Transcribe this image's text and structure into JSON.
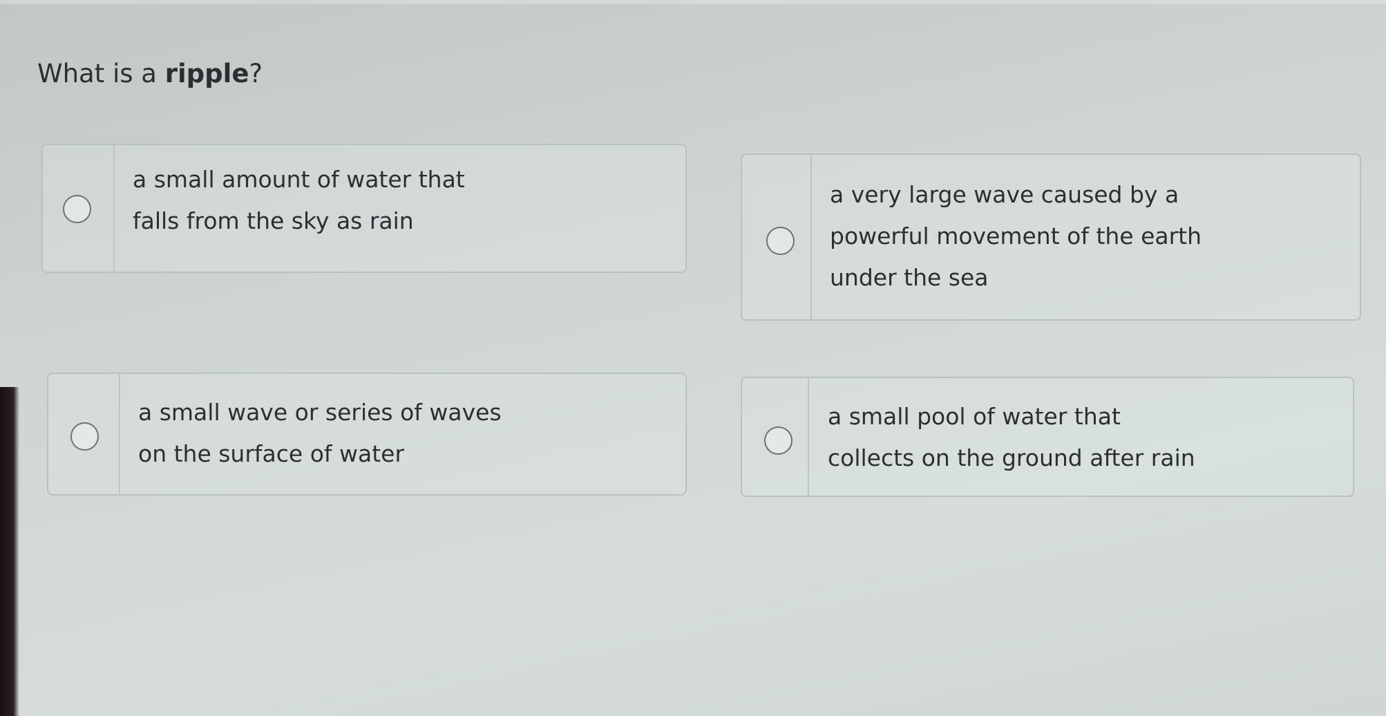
{
  "question": {
    "prefix": "What is a ",
    "keyword": "ripple",
    "suffix": "?"
  },
  "options": [
    {
      "lines": [
        "a small amount of water that",
        "falls from the sky as rain"
      ]
    },
    {
      "lines": [
        "a very large wave caused by a",
        "powerful movement of the earth",
        "under the sea"
      ]
    },
    {
      "lines": [
        "a small wave or series of waves",
        "on the surface of water"
      ]
    },
    {
      "lines": [
        "a small pool of water that",
        "collects on the ground after rain"
      ]
    }
  ]
}
